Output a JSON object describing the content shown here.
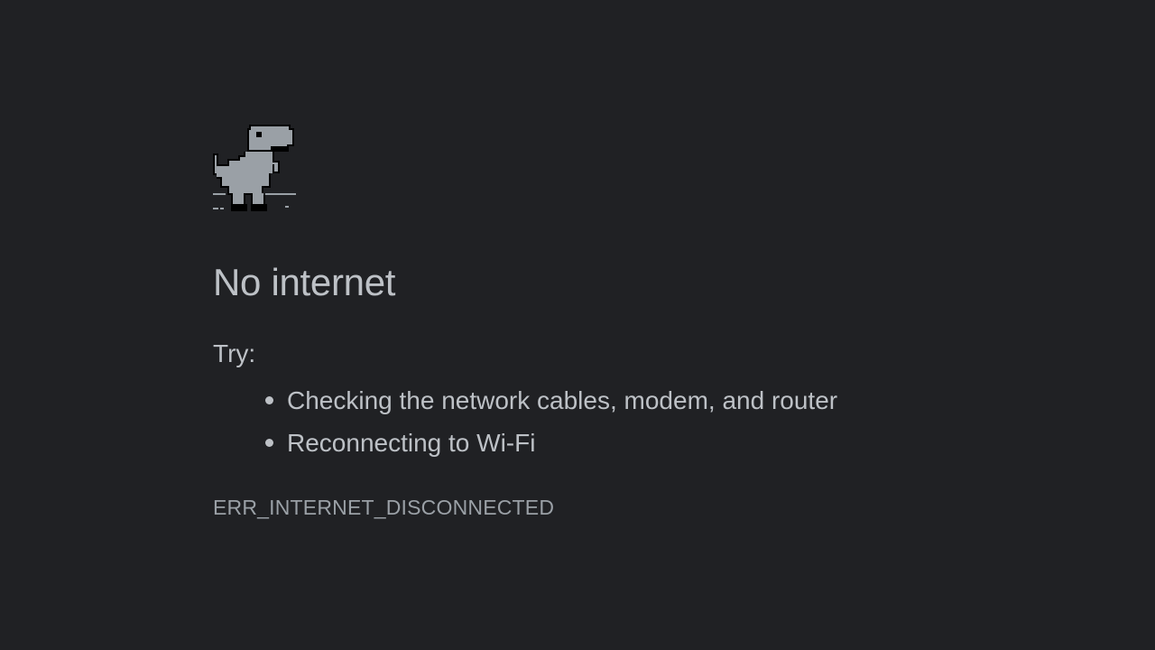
{
  "page": {
    "icon": "offline-dino-icon",
    "title": "No internet",
    "try_label": "Try:",
    "suggestions": [
      "Checking the network cables, modem, and router",
      "Reconnecting to Wi-Fi"
    ],
    "error_code": "ERR_INTERNET_DISCONNECTED"
  },
  "colors": {
    "background": "#202124",
    "text": "#bdc1c6",
    "secondary_text": "#9aa0a6",
    "dino_fill": "#9aa0a6",
    "dino_outline": "#000000"
  }
}
